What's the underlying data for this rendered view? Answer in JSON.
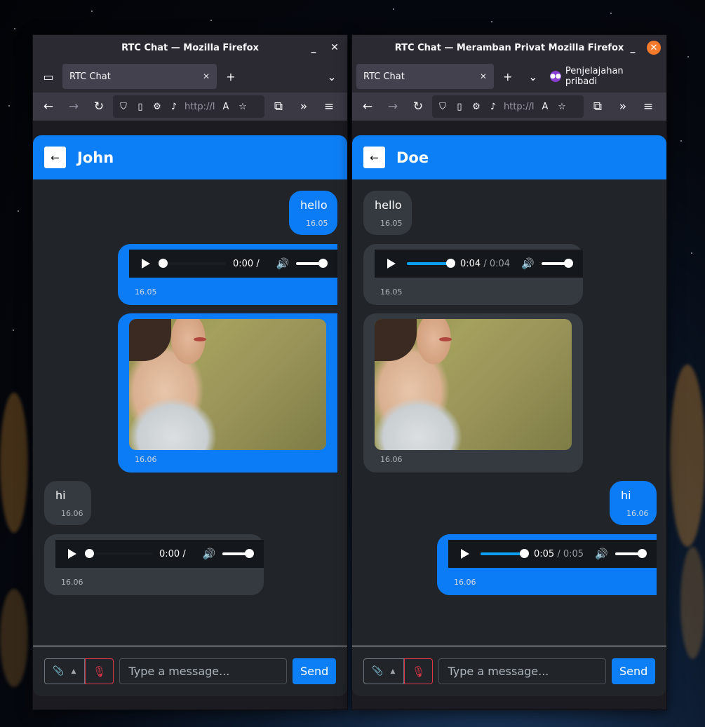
{
  "windows": [
    {
      "title": "RTC Chat — Mozilla Firefox",
      "tab_label": "RTC Chat",
      "url": "http://l",
      "contact": "John",
      "private_label": "",
      "messages": [
        {
          "type": "text",
          "dir": "out",
          "text": "hello",
          "time": "16.05"
        },
        {
          "type": "audio",
          "dir": "out",
          "current": "0:00",
          "duration": "",
          "progress": 0,
          "time": "16.05"
        },
        {
          "type": "image",
          "dir": "out",
          "time": "16.06"
        },
        {
          "type": "text",
          "dir": "in",
          "text": "hi",
          "time": "16.06"
        },
        {
          "type": "audio",
          "dir": "in",
          "current": "0:00",
          "duration": "",
          "progress": 0,
          "time": "16.06"
        }
      ]
    },
    {
      "title": "RTC Chat — Meramban Privat Mozilla Firefox",
      "tab_label": "RTC Chat",
      "url": "http://l",
      "contact": "Doe",
      "private_label": "Penjelajahan pribadi",
      "messages": [
        {
          "type": "text",
          "dir": "in",
          "text": "hello",
          "time": "16.05"
        },
        {
          "type": "audio",
          "dir": "in",
          "current": "0:04",
          "duration": "0:04",
          "progress": 1,
          "time": "16.05"
        },
        {
          "type": "image",
          "dir": "in",
          "time": "16.06"
        },
        {
          "type": "text",
          "dir": "out",
          "text": "hi",
          "time": "16.06"
        },
        {
          "type": "audio",
          "dir": "out",
          "current": "0:05",
          "duration": "0:05",
          "progress": 1,
          "time": "16.06"
        }
      ]
    }
  ],
  "composer": {
    "placeholder": "Type a message...",
    "send_label": "Send"
  },
  "colors": {
    "accent": "#0d7ff6",
    "bubble_in": "#343a40",
    "bg": "#212529",
    "mic": "#dc3545"
  }
}
